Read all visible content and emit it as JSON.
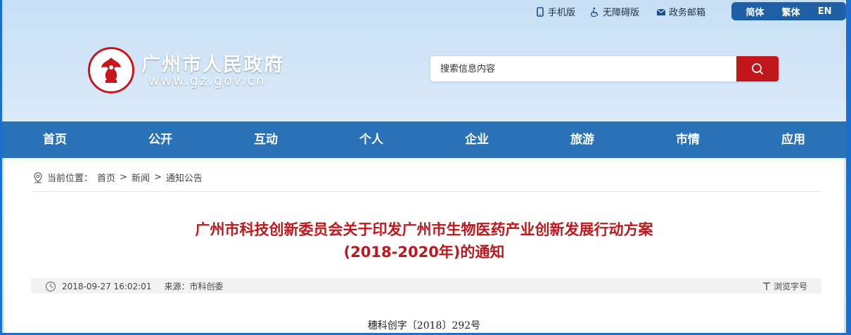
{
  "topbar": {
    "mobile": "手机版",
    "accessible": "无障碍版",
    "email": "政务邮箱",
    "lang": [
      "简体",
      "繁体",
      "EN"
    ]
  },
  "header": {
    "site_name": "广州市人民政府",
    "site_url": "www.gz.gov.cn",
    "search_placeholder": "搜索信息内容"
  },
  "nav": [
    "首页",
    "公开",
    "互动",
    "个人",
    "企业",
    "旅游",
    "市情",
    "应用"
  ],
  "breadcrumb": {
    "label": "当前位置：",
    "items": [
      "首页",
      "新闻",
      "通知公告"
    ],
    "sep": ">"
  },
  "article": {
    "title_line1": "广州市科技创新委员会关于印发广州市生物医药产业创新发展行动方案",
    "title_line2": "(2018-2020年)的通知",
    "date": "2018-09-27 16:02:01",
    "source": "来源：市科创委",
    "font_size_label": "浏览字号",
    "doc_number": "穗科创字〔2018〕292号"
  },
  "colors": {
    "brand_red": "#c0161c",
    "nav_blue": "#2a72b8",
    "lang_blue": "#1f5fa6"
  }
}
